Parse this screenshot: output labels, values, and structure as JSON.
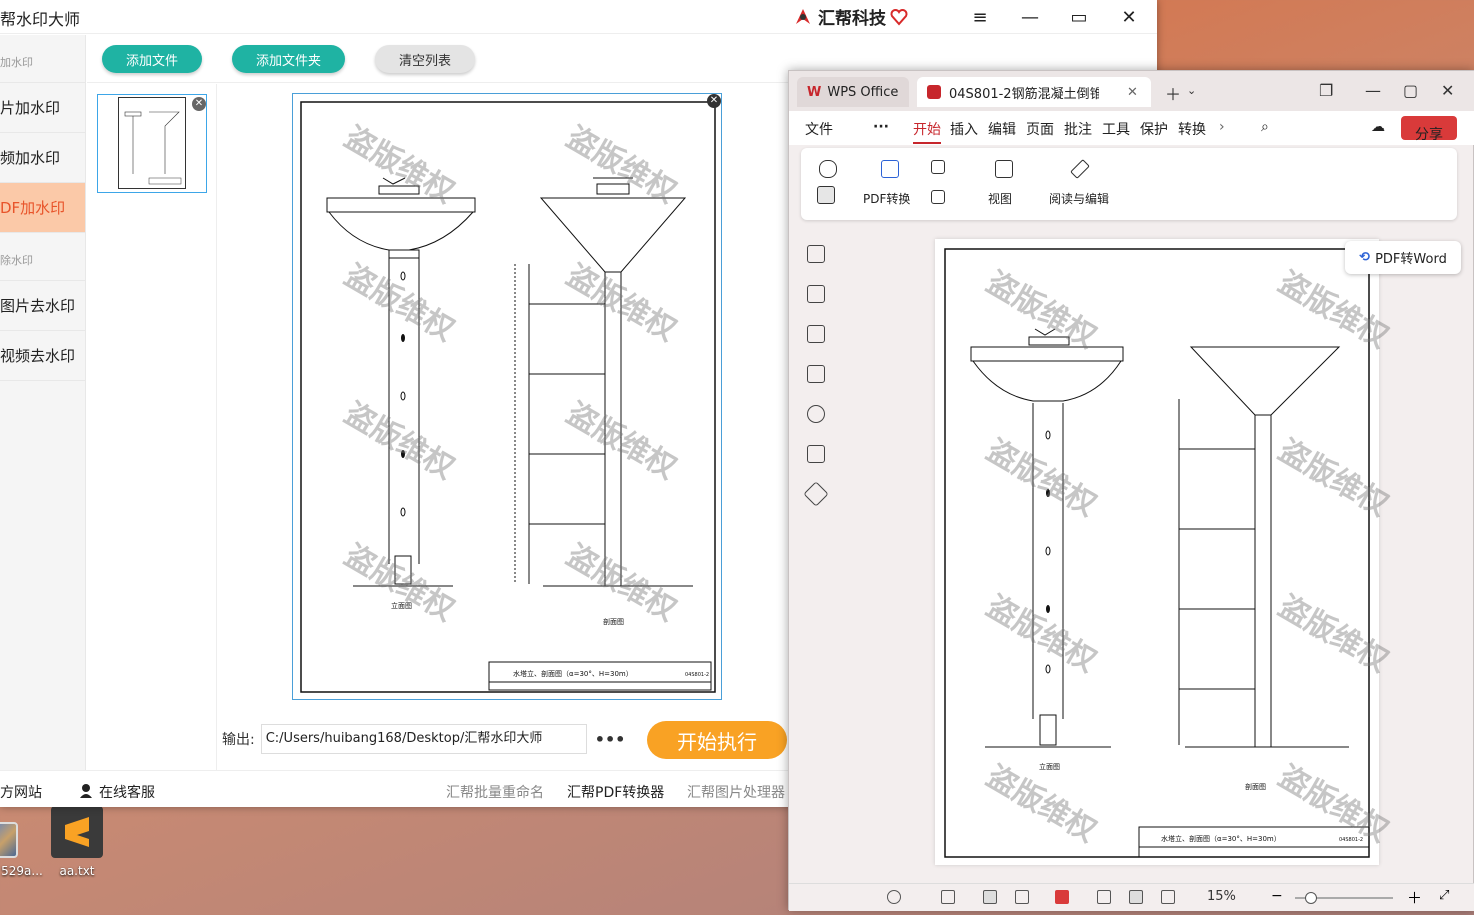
{
  "app": {
    "title": "帮水印大师",
    "brand": "汇帮科技",
    "window_controls": [
      "menu-icon",
      "minimize-icon",
      "maximize-icon",
      "close-icon"
    ]
  },
  "sidebar": {
    "groups": [
      {
        "label": "加水印",
        "items": [
          "片加水印",
          "频加水印",
          "DF加水印"
        ]
      },
      {
        "label": "除水印",
        "items": [
          "图片去水印",
          "视频去水印"
        ]
      }
    ],
    "active": "DF加水印"
  },
  "toolbar": {
    "add_file": "添加文件",
    "add_folder": "添加文件夹",
    "clear_list": "清空列表"
  },
  "watermark_text": "盗版维权",
  "drawing": {
    "front_label": "立面图",
    "section_label": "剖面图",
    "title_block": "水塔立、剖面图（α=30°、H=30m）",
    "sheet_no": "04S801-2"
  },
  "output": {
    "label": "输出:",
    "path": "C:/Users/huibang168/Desktop/汇帮水印大师",
    "more": "•••"
  },
  "start_button": "开始执行",
  "footer": {
    "website": "方网站",
    "service": "在线客服",
    "links": [
      "汇帮批量重命名",
      "汇帮PDF转换器",
      "汇帮图片处理器"
    ]
  },
  "desktop": {
    "icons": [
      {
        "label": "529a...",
        "icon": "image-file-icon"
      },
      {
        "label": "aa.txt",
        "icon": "sublime-text-icon"
      }
    ]
  },
  "wps": {
    "home_tab": "WPS Office",
    "doc_tab": "04S801-2钢筋混凝土倒锥",
    "menu": [
      "文件",
      "开始",
      "插入",
      "编辑",
      "页面",
      "批注",
      "工具",
      "保护",
      "转换"
    ],
    "active_menu": "开始",
    "share": "分享",
    "ribbon": {
      "pdf_convert": "PDF转换",
      "view": "视图",
      "read_edit": "阅读与编辑"
    },
    "pdf_to_word": "PDF转Word",
    "zoom": "15%"
  },
  "colors": {
    "green_button": "#1fb3a3",
    "orange_button": "#f9a224",
    "active_item_bg": "#fbc9a8",
    "active_item_text": "#e8542a",
    "wps_red": "#c7262c"
  }
}
